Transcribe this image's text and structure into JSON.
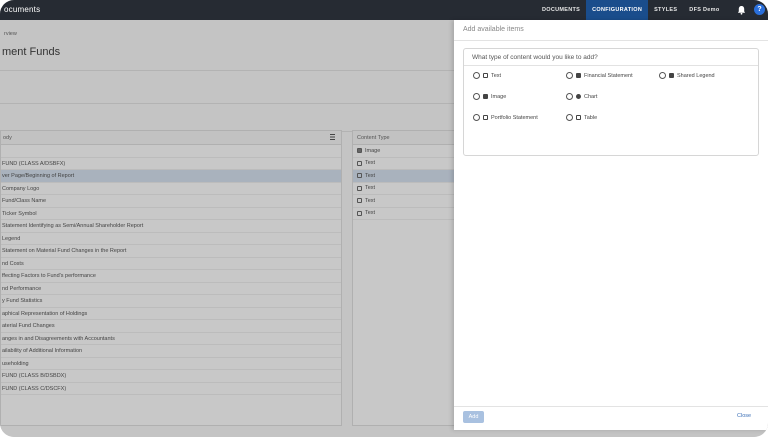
{
  "app": {
    "title": "ocuments"
  },
  "nav": [
    {
      "label": "DOCUMENTS",
      "active": false
    },
    {
      "label": "CONFIGURATION",
      "active": true
    },
    {
      "label": "STYLES",
      "active": false
    },
    {
      "label": "DFS Demo",
      "active": false
    }
  ],
  "help_label": "?",
  "page": {
    "breadcrumb": "rview",
    "title": "ment Funds"
  },
  "tree": {
    "header": "ody",
    "rows": [
      {
        "label": "",
        "selected": false
      },
      {
        "label": "FUND (CLASS A/DSBFX)",
        "selected": false
      },
      {
        "label": "ver Page/Beginning of Report",
        "selected": true
      },
      {
        "label": " Company Logo",
        "selected": false
      },
      {
        "label": "  Fund/Class Name",
        "selected": false
      },
      {
        "label": "  Ticker Symbol",
        "selected": false
      },
      {
        "label": "  Statement Identifying as Semi/Annual Shareholder Report",
        "selected": false
      },
      {
        "label": "  Legend",
        "selected": false
      },
      {
        "label": "  Statement on Material Fund Changes in the Report",
        "selected": false
      },
      {
        "label": "nd Costs",
        "selected": false
      },
      {
        "label": "ffecting Factors to Fund's performance",
        "selected": false
      },
      {
        "label": "nd Performance",
        "selected": false
      },
      {
        "label": "y Fund Statistics",
        "selected": false
      },
      {
        "label": "aphical Representation of Holdings",
        "selected": false
      },
      {
        "label": "aterial Fund Changes",
        "selected": false
      },
      {
        "label": "anges in and Disagreements with Accountants",
        "selected": false
      },
      {
        "label": "ailability of Additional Information",
        "selected": false
      },
      {
        "label": "useholding",
        "selected": false
      },
      {
        "label": "FUND (CLASS B/DSBDX)",
        "selected": false
      },
      {
        "label": "FUND (CLASS C/DSCFX)",
        "selected": false
      }
    ]
  },
  "content_table": {
    "header": "Content Type",
    "rows": [
      {
        "icon": "image-icon",
        "label": "Image",
        "selected": false
      },
      {
        "icon": "text-icon",
        "label": "Text",
        "selected": false
      },
      {
        "icon": "text-icon",
        "label": "Text",
        "selected": true
      },
      {
        "icon": "text-icon",
        "label": "Text",
        "selected": false
      },
      {
        "icon": "text-icon",
        "label": "Text",
        "selected": false
      },
      {
        "icon": "text-icon",
        "label": "Text",
        "selected": false
      }
    ]
  },
  "panel": {
    "title": "Add available items",
    "question": "What type of content would you like to add?",
    "options": [
      {
        "label": "Text",
        "icon": "text-icon"
      },
      {
        "label": "Financial Statement",
        "icon": "financial-statement-icon"
      },
      {
        "label": "Shared Legend",
        "icon": "shared-legend-icon"
      },
      {
        "label": "Image",
        "icon": "image-icon"
      },
      {
        "label": "Chart",
        "icon": "chart-icon"
      },
      {
        "label": "Portfolio Statement",
        "icon": "portfolio-statement-icon"
      },
      {
        "label": "Table",
        "icon": "table-icon"
      }
    ],
    "add_label": "Add",
    "close_label": "Close"
  }
}
